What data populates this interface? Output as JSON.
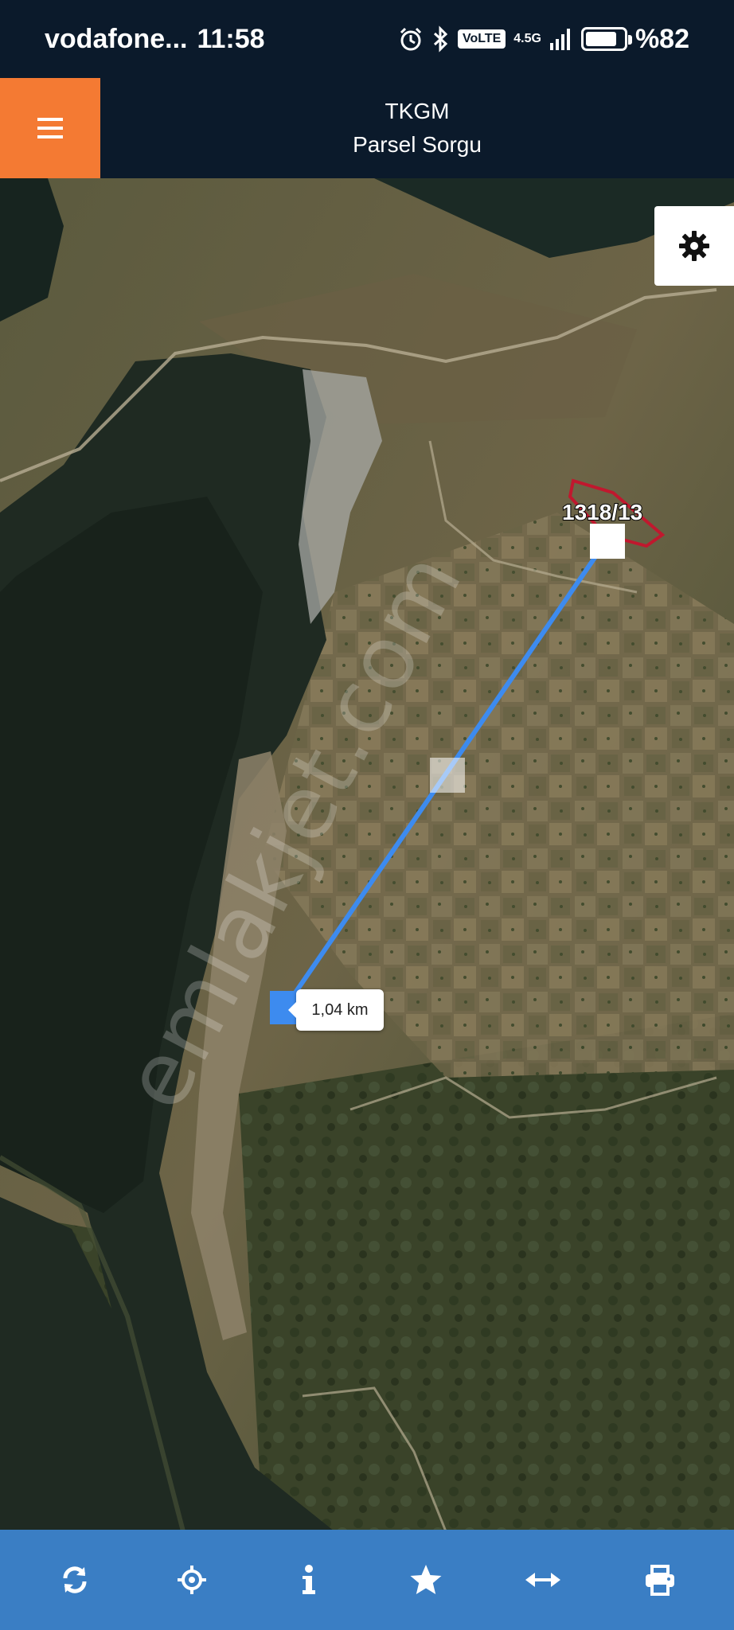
{
  "status_bar": {
    "carrier": "vodafone...",
    "time": "11:58",
    "volte": "VoLTE",
    "network": "4.5G",
    "battery": "%82",
    "battery_level": 0.82
  },
  "header": {
    "title": "TKGM",
    "subtitle": "Parsel Sorgu"
  },
  "map": {
    "parcel_label": "1318/13",
    "distance_label": "1,04 km",
    "watermark": "emlakjet.com",
    "line_color": "#3d8bef",
    "parcel_color": "#c0182e"
  },
  "toolbar": {
    "buttons": [
      "refresh-icon",
      "locate-icon",
      "info-icon",
      "star-icon",
      "measure-icon",
      "print-icon"
    ],
    "color": "#3a7ec4"
  },
  "colors": {
    "menu_button": "#f47a33",
    "app_bar": "#0b1a2b"
  }
}
